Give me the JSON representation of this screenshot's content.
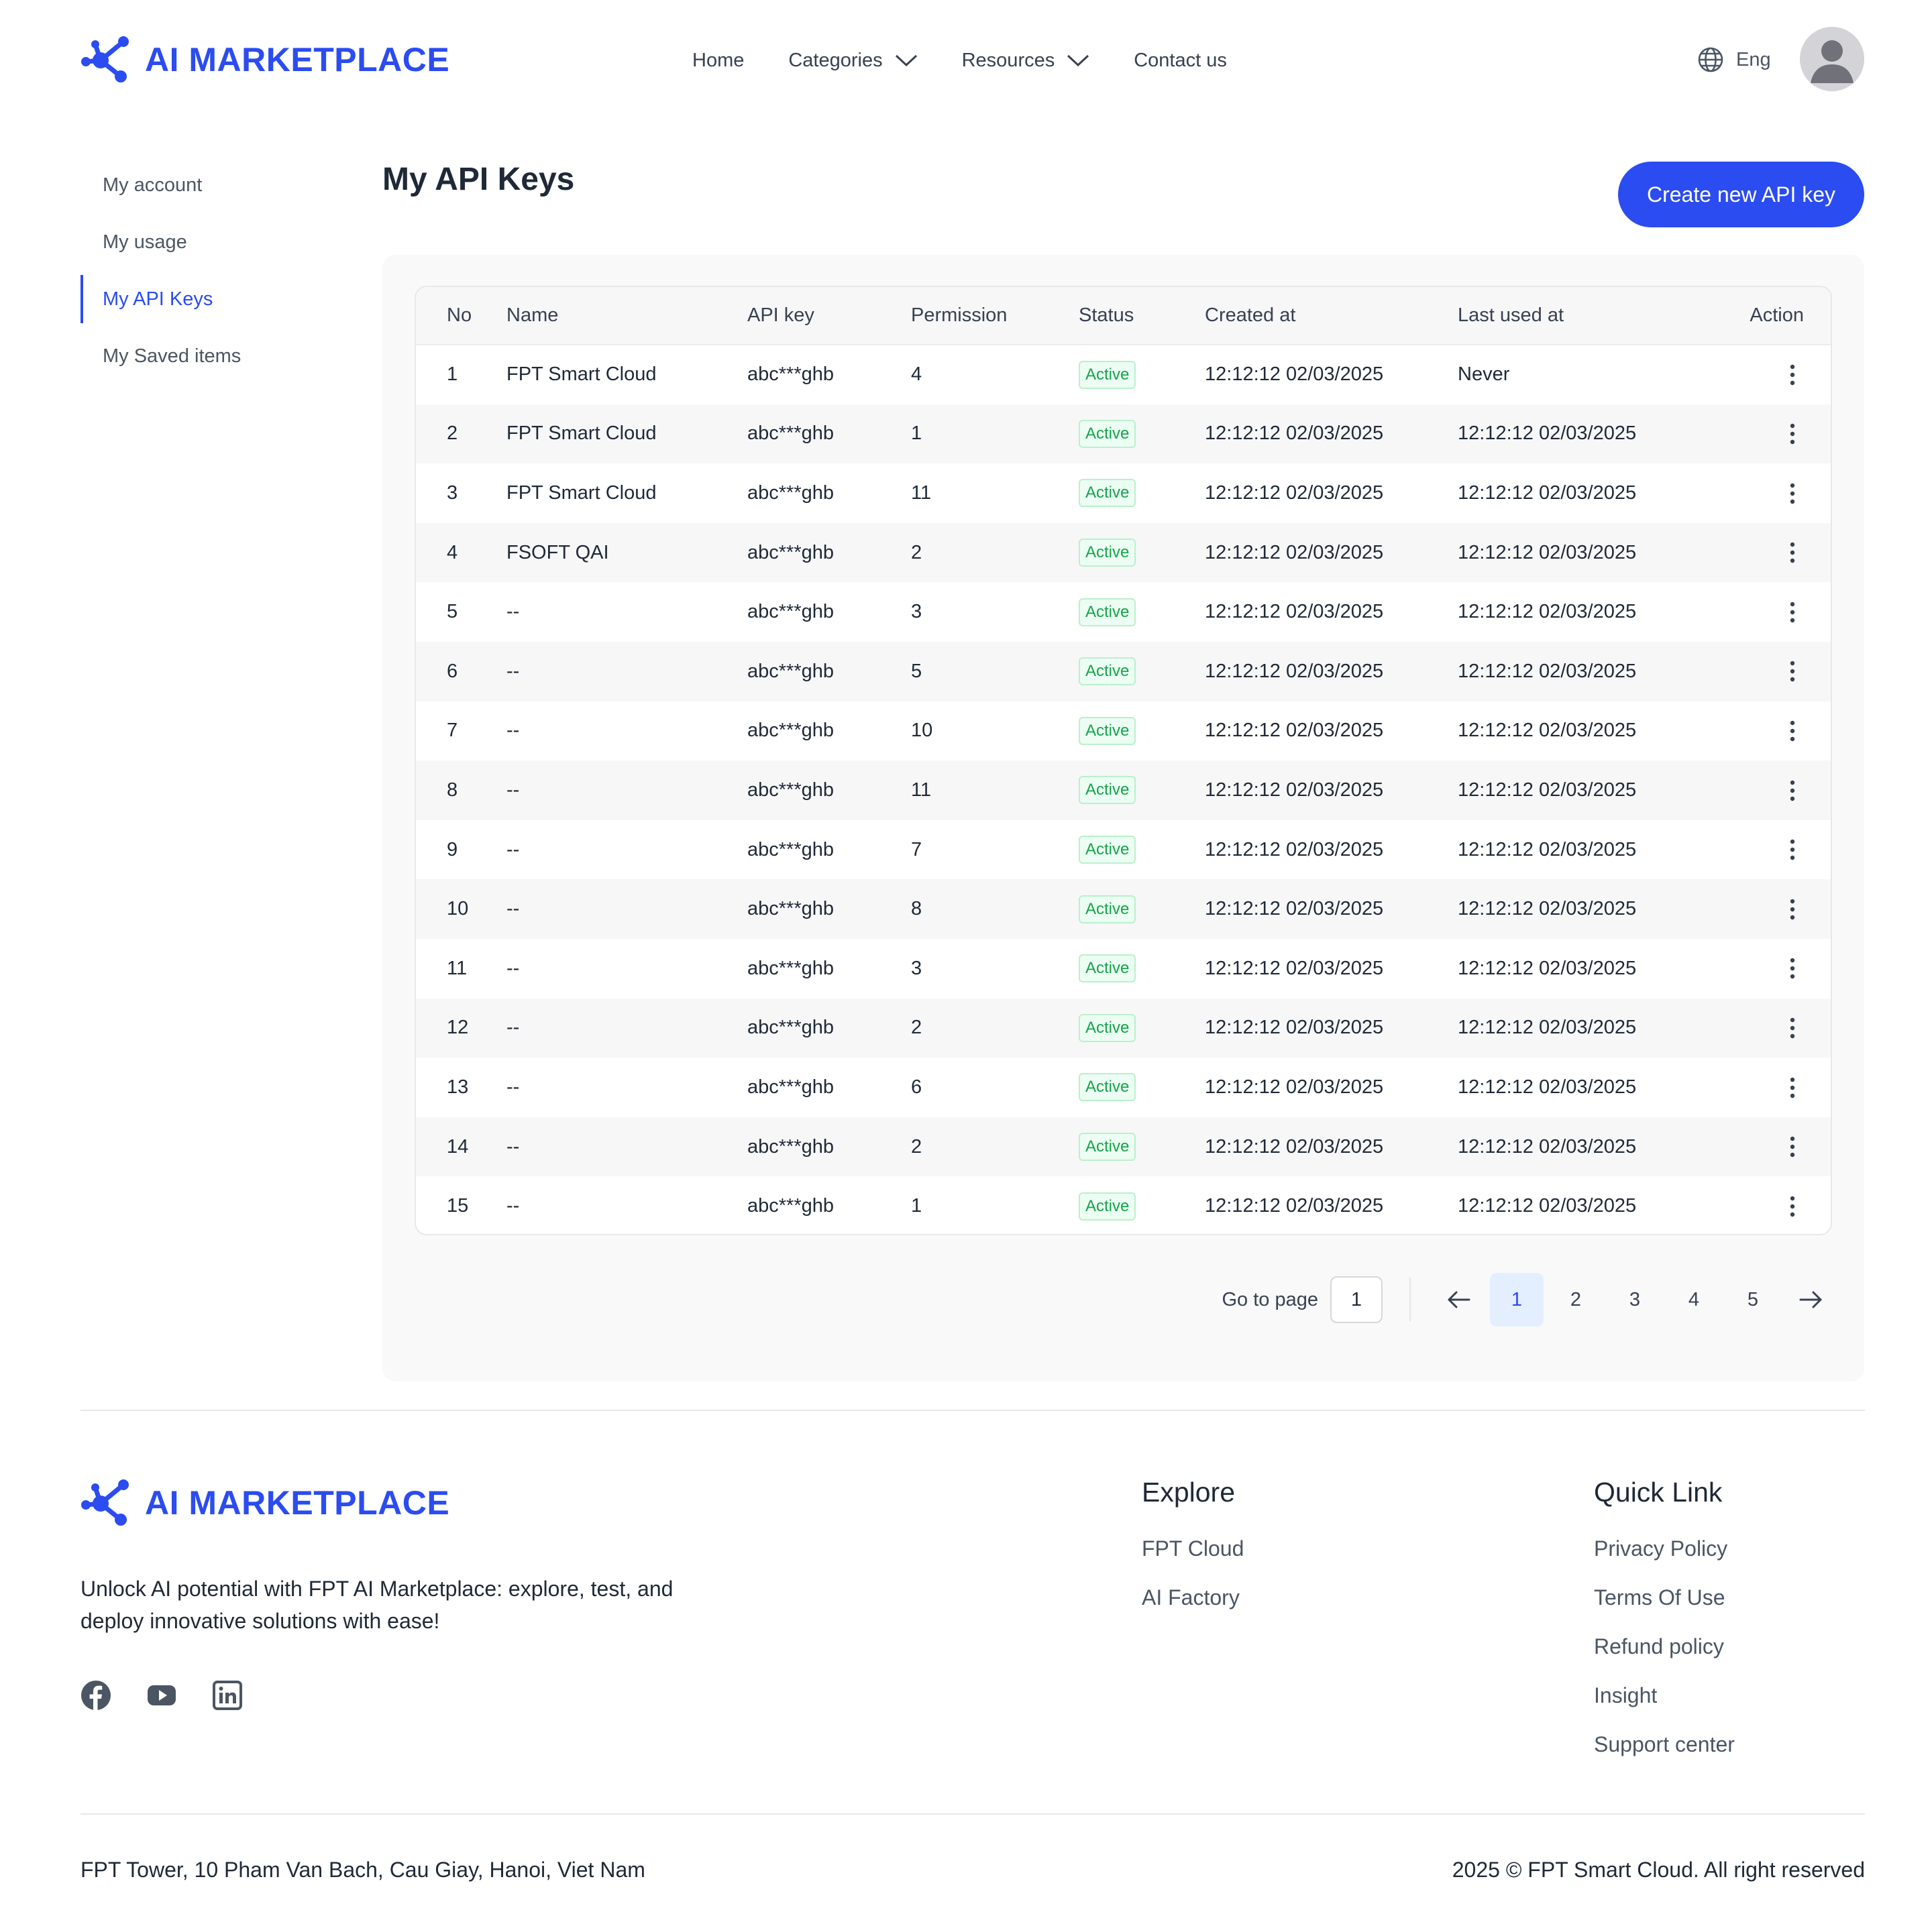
{
  "brand": {
    "name": "AI MARKETPLACE",
    "color": "#2b4cf0"
  },
  "nav": {
    "items": [
      {
        "label": "Home",
        "has_dropdown": false
      },
      {
        "label": "Categories",
        "has_dropdown": true
      },
      {
        "label": "Resources",
        "has_dropdown": true
      },
      {
        "label": "Contact us",
        "has_dropdown": false
      }
    ],
    "language": "Eng"
  },
  "sidebar": {
    "items": [
      {
        "label": "My account",
        "active": false
      },
      {
        "label": "My usage",
        "active": false
      },
      {
        "label": "My API Keys",
        "active": true
      },
      {
        "label": "My Saved items",
        "active": false
      }
    ]
  },
  "main": {
    "title": "My API Keys",
    "create_button": "Create new API key"
  },
  "table": {
    "columns": [
      "No",
      "Name",
      "API key",
      "Permission",
      "Status",
      "Created at",
      "Last used at",
      "Action"
    ],
    "rows": [
      {
        "no": "1",
        "name": "FPT Smart Cloud",
        "api_key": "abc***ghb",
        "permission": "4",
        "status": "Active",
        "created_at": "12:12:12 02/03/2025",
        "last_used_at": "Never"
      },
      {
        "no": "2",
        "name": "FPT Smart Cloud",
        "api_key": "abc***ghb",
        "permission": "1",
        "status": "Active",
        "created_at": "12:12:12 02/03/2025",
        "last_used_at": "12:12:12 02/03/2025"
      },
      {
        "no": "3",
        "name": "FPT Smart Cloud",
        "api_key": "abc***ghb",
        "permission": "11",
        "status": "Active",
        "created_at": "12:12:12 02/03/2025",
        "last_used_at": "12:12:12 02/03/2025"
      },
      {
        "no": "4",
        "name": "FSOFT QAI",
        "api_key": "abc***ghb",
        "permission": "2",
        "status": "Active",
        "created_at": "12:12:12 02/03/2025",
        "last_used_at": "12:12:12 02/03/2025"
      },
      {
        "no": "5",
        "name": "--",
        "api_key": "abc***ghb",
        "permission": "3",
        "status": "Active",
        "created_at": "12:12:12 02/03/2025",
        "last_used_at": "12:12:12 02/03/2025"
      },
      {
        "no": "6",
        "name": "--",
        "api_key": "abc***ghb",
        "permission": "5",
        "status": "Active",
        "created_at": "12:12:12 02/03/2025",
        "last_used_at": "12:12:12 02/03/2025"
      },
      {
        "no": "7",
        "name": "--",
        "api_key": "abc***ghb",
        "permission": "10",
        "status": "Active",
        "created_at": "12:12:12 02/03/2025",
        "last_used_at": "12:12:12 02/03/2025"
      },
      {
        "no": "8",
        "name": "--",
        "api_key": "abc***ghb",
        "permission": "11",
        "status": "Active",
        "created_at": "12:12:12 02/03/2025",
        "last_used_at": "12:12:12 02/03/2025"
      },
      {
        "no": "9",
        "name": "--",
        "api_key": "abc***ghb",
        "permission": "7",
        "status": "Active",
        "created_at": "12:12:12 02/03/2025",
        "last_used_at": "12:12:12 02/03/2025"
      },
      {
        "no": "10",
        "name": "--",
        "api_key": "abc***ghb",
        "permission": "8",
        "status": "Active",
        "created_at": "12:12:12 02/03/2025",
        "last_used_at": "12:12:12 02/03/2025"
      },
      {
        "no": "11",
        "name": "--",
        "api_key": "abc***ghb",
        "permission": "3",
        "status": "Active",
        "created_at": "12:12:12 02/03/2025",
        "last_used_at": "12:12:12 02/03/2025"
      },
      {
        "no": "12",
        "name": "--",
        "api_key": "abc***ghb",
        "permission": "2",
        "status": "Active",
        "created_at": "12:12:12 02/03/2025",
        "last_used_at": "12:12:12 02/03/2025"
      },
      {
        "no": "13",
        "name": "--",
        "api_key": "abc***ghb",
        "permission": "6",
        "status": "Active",
        "created_at": "12:12:12 02/03/2025",
        "last_used_at": "12:12:12 02/03/2025"
      },
      {
        "no": "14",
        "name": "--",
        "api_key": "abc***ghb",
        "permission": "2",
        "status": "Active",
        "created_at": "12:12:12 02/03/2025",
        "last_used_at": "12:12:12 02/03/2025"
      },
      {
        "no": "15",
        "name": "--",
        "api_key": "abc***ghb",
        "permission": "1",
        "status": "Active",
        "created_at": "12:12:12 02/03/2025",
        "last_used_at": "12:12:12 02/03/2025"
      }
    ]
  },
  "pagination": {
    "goto_label": "Go to page",
    "goto_value": "1",
    "pages": [
      "1",
      "2",
      "3",
      "4",
      "5"
    ],
    "current": "1"
  },
  "footer": {
    "brand": "AI MARKETPLACE",
    "tagline": "Unlock AI potential with FPT AI Marketplace: explore, test, and deploy innovative solutions with ease!",
    "socials": [
      "facebook-icon",
      "youtube-icon",
      "linkedin-icon"
    ],
    "explore": {
      "title": "Explore",
      "links": [
        "FPT Cloud",
        "AI Factory"
      ]
    },
    "quick_link": {
      "title": "Quick Link",
      "links": [
        "Privacy Policy",
        "Terms Of Use",
        "Refund policy",
        "Insight",
        "Support center"
      ]
    },
    "address": "FPT Tower, 10 Pham Van Bach, Cau Giay, Hanoi, Viet Nam",
    "copyright": "2025 © FPT Smart Cloud. All right reserved"
  },
  "colors": {
    "accent": "#2b4cf0",
    "status_active": "#16a34a",
    "status_active_bg": "#ecfdf3",
    "page_active_bg": "#e3efff"
  }
}
